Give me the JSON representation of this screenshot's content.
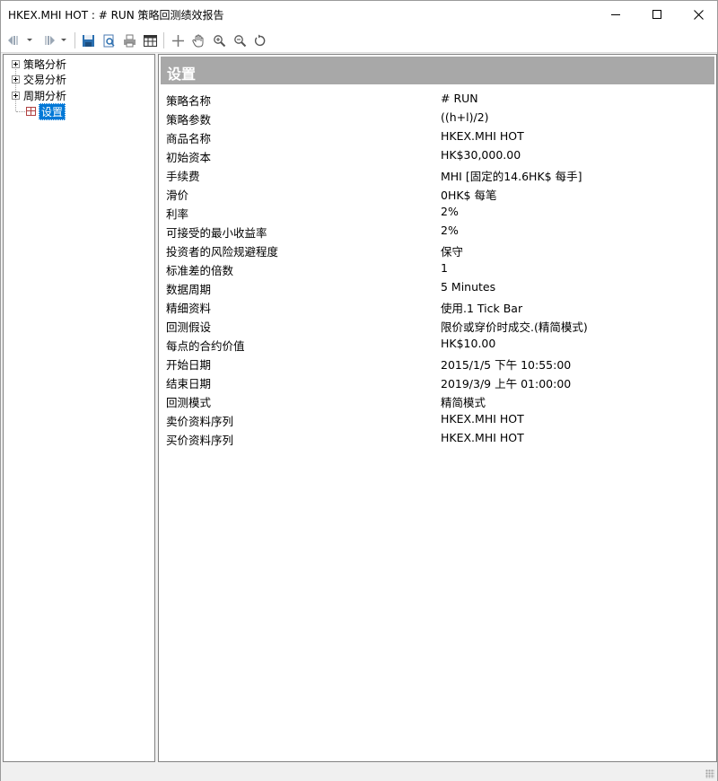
{
  "window": {
    "title": "HKEX.MHI HOT : # RUN 策略回测绩效报告",
    "minimize": "minimize",
    "maximize": "maximize",
    "close": "close"
  },
  "toolbar": {
    "icons": [
      "back-icon",
      "forward-icon",
      "save-icon",
      "print-preview-icon",
      "print-icon",
      "table-icon",
      "crosshair-icon",
      "hand-pan-icon",
      "zoom-in-icon",
      "zoom-out-icon",
      "reset-zoom-icon"
    ]
  },
  "tree": {
    "items": [
      {
        "label": "策略分析",
        "expandable": true
      },
      {
        "label": "交易分析",
        "expandable": true
      },
      {
        "label": "周期分析",
        "expandable": true
      },
      {
        "label": "设置",
        "expandable": false,
        "selected": true
      }
    ]
  },
  "settings": {
    "header": "设置",
    "rows": [
      {
        "label": "策略名称",
        "value": "# RUN"
      },
      {
        "label": "策略参数",
        "value": "((h+l)/2)"
      },
      {
        "label": "商品名称",
        "value": "HKEX.MHI HOT"
      },
      {
        "label": "初始资本",
        "value": "HK$30,000.00"
      },
      {
        "label": "手续费",
        "value": "MHI [固定的14.6HK$ 每手]"
      },
      {
        "label": "滑价",
        "value": "0HK$ 每笔"
      },
      {
        "label": "利率",
        "value": "2%"
      },
      {
        "label": "可接受的最小收益率",
        "value": "2%"
      },
      {
        "label": "投资者的风险规避程度",
        "value": "保守"
      },
      {
        "label": "标准差的倍数",
        "value": "1"
      },
      {
        "label": "数据周期",
        "value": "5 Minutes"
      },
      {
        "label": "精细资料",
        "value": "使用.1 Tick Bar"
      },
      {
        "label": "回测假设",
        "value": "限价或穿价时成交.(精简模式)"
      },
      {
        "label": "每点的合约价值",
        "value": "HK$10.00"
      },
      {
        "label": "开始日期",
        "value": "2015/1/5 下午 10:55:00"
      },
      {
        "label": "结束日期",
        "value": "2019/3/9 上午 01:00:00"
      },
      {
        "label": "回测模式",
        "value": "精简模式"
      },
      {
        "label": "卖价资料序列",
        "value": "HKEX.MHI HOT"
      },
      {
        "label": "买价资料序列",
        "value": "HKEX.MHI HOT"
      }
    ]
  },
  "colors": {
    "header_bg": "#a8a8a8",
    "selection": "#0078d7"
  }
}
